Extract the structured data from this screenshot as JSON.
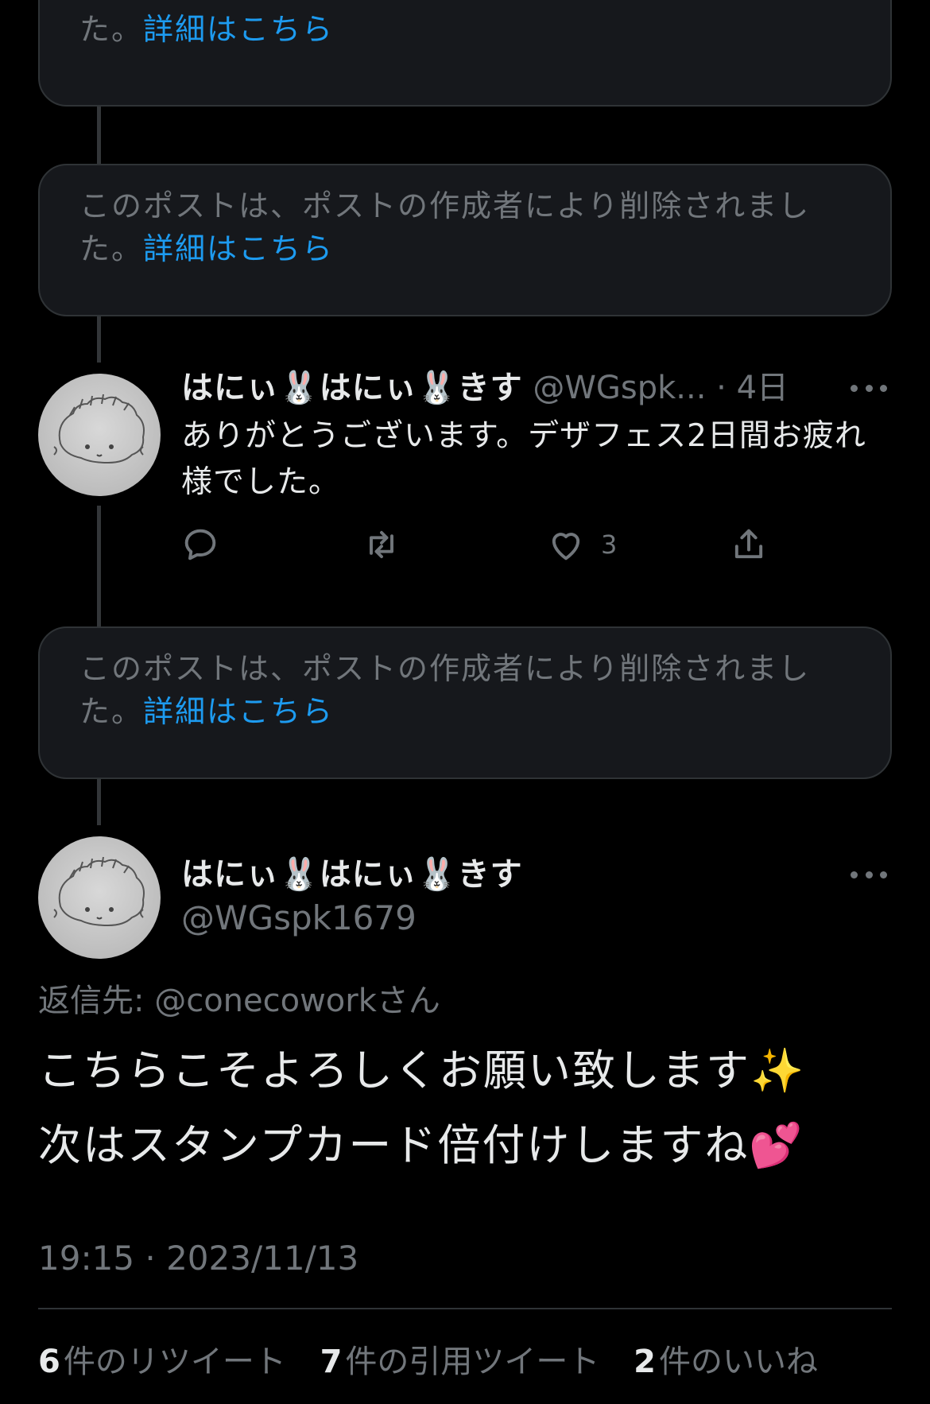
{
  "deleted_notice": {
    "line1": "このポストは、ポストの作成者により削除されまし",
    "line2_prefix": "た。",
    "link": "詳細はこちら"
  },
  "reply": {
    "display_name": "はにぃ🐰はにぃ🐰きす",
    "handle": "@WGspk...",
    "age": "4日",
    "text": "ありがとうございます。デザフェス2日間お疲れ様でした。",
    "like_count": "3"
  },
  "main_post": {
    "display_name": "はにぃ🐰はにぃ🐰きす",
    "handle": "@WGspk1679",
    "reply_to_label": "返信先:",
    "reply_to_handle": "@conecowork",
    "reply_to_suffix": "さん",
    "text_line1": "こちらこそよろしくお願い致します✨",
    "text_line2": "次はスタンプカード倍付けしますね💕",
    "timestamp": "19:15 · 2023/11/13"
  },
  "stats": {
    "retweets_count": "6",
    "retweets_label": "件のリツイート",
    "quotes_count": "7",
    "quotes_label": "件の引用ツイート",
    "likes_count": "2",
    "likes_label": "件のいいね"
  },
  "colors": {
    "background": "#000000",
    "link": "#1d9bf0",
    "muted": "#71767b",
    "card": "#16181c"
  }
}
